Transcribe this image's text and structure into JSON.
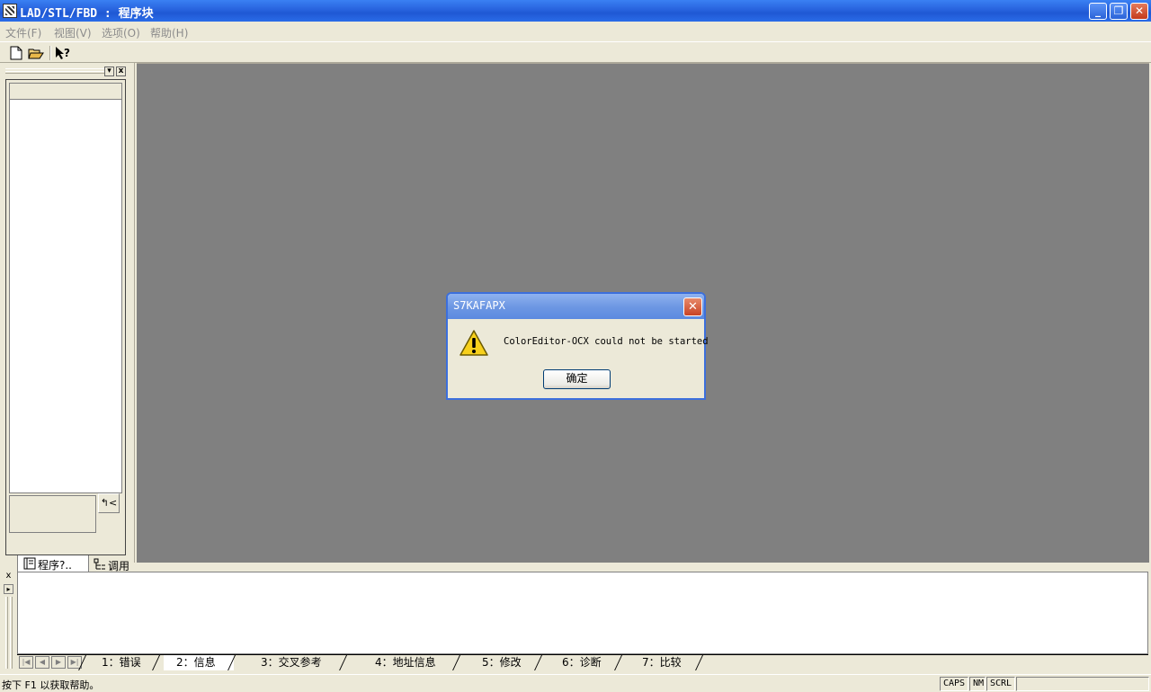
{
  "window": {
    "title": "LAD/STL/FBD  : 程序块",
    "minimize": "_",
    "restore": "❐",
    "close": "✕"
  },
  "menu": [
    {
      "label": "文件(F)"
    },
    {
      "label": "视图(V)"
    },
    {
      "label": "选项(O)"
    },
    {
      "label": "帮助(H)"
    }
  ],
  "left_pane": {
    "pin": "▾",
    "close": "x",
    "bottom_button": "↰<",
    "tabs": [
      {
        "label": "程序?.."
      },
      {
        "label": "调用"
      }
    ]
  },
  "dialog": {
    "title": "S7KAFAPX",
    "close": "✕",
    "message": "ColorEditor-OCX could not be started",
    "ok_label": "确定"
  },
  "output": {
    "close": "x",
    "expand": "▸",
    "nav": [
      "|◀",
      "◀",
      "▶",
      "▶|"
    ],
    "tabs": [
      {
        "label": "1：错误"
      },
      {
        "label": "2：信息"
      },
      {
        "label": "3：交叉参考"
      },
      {
        "label": "4：地址信息"
      },
      {
        "label": "5：修改"
      },
      {
        "label": "6：诊断"
      },
      {
        "label": "7：比较"
      }
    ],
    "active_tab": "2：信息"
  },
  "status": {
    "text": "按下 F1 以获取帮助。",
    "caps": "CAPS",
    "num": "NM",
    "scrl": "SCRL"
  },
  "colors": {
    "titlebar": "#2a66e0",
    "mdi_background": "#808080",
    "chrome": "#ece9d8",
    "warning_yellow": "#f7d01c"
  }
}
